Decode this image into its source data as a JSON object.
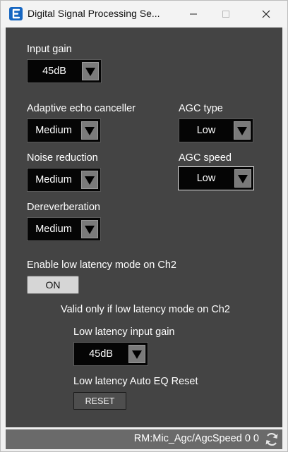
{
  "window": {
    "title": "Digital Signal Processing Se...",
    "controls": {
      "minimize": "minimize",
      "maximize": "maximize",
      "close": "close"
    }
  },
  "colors": {
    "panel": "#444444",
    "select_bg": "#050505",
    "status_bar": "#6a6a6a",
    "app_icon": "#1666c1"
  },
  "input_gain": {
    "label": "Input gain",
    "value": "45dB"
  },
  "adaptive_echo_canceller": {
    "label": "Adaptive echo canceller",
    "value": "Medium"
  },
  "agc_type": {
    "label": "AGC type",
    "value": "Low"
  },
  "noise_reduction": {
    "label": "Noise reduction",
    "value": "Medium"
  },
  "agc_speed": {
    "label": "AGC speed",
    "value": "Low"
  },
  "dereverberation": {
    "label": "Dereverberation",
    "value": "Medium"
  },
  "low_latency_mode": {
    "label": "Enable low latency mode on Ch2",
    "button": "ON"
  },
  "low_latency_note": "Valid only if low latency mode on Ch2",
  "low_latency_input_gain": {
    "label": "Low latency input gain",
    "value": "45dB"
  },
  "low_latency_auto_eq": {
    "label": "Low latency Auto EQ Reset",
    "button": "RESET"
  },
  "status": {
    "text": "RM:Mic_Agc/AgcSpeed 0 0",
    "icon": "refresh-icon"
  }
}
